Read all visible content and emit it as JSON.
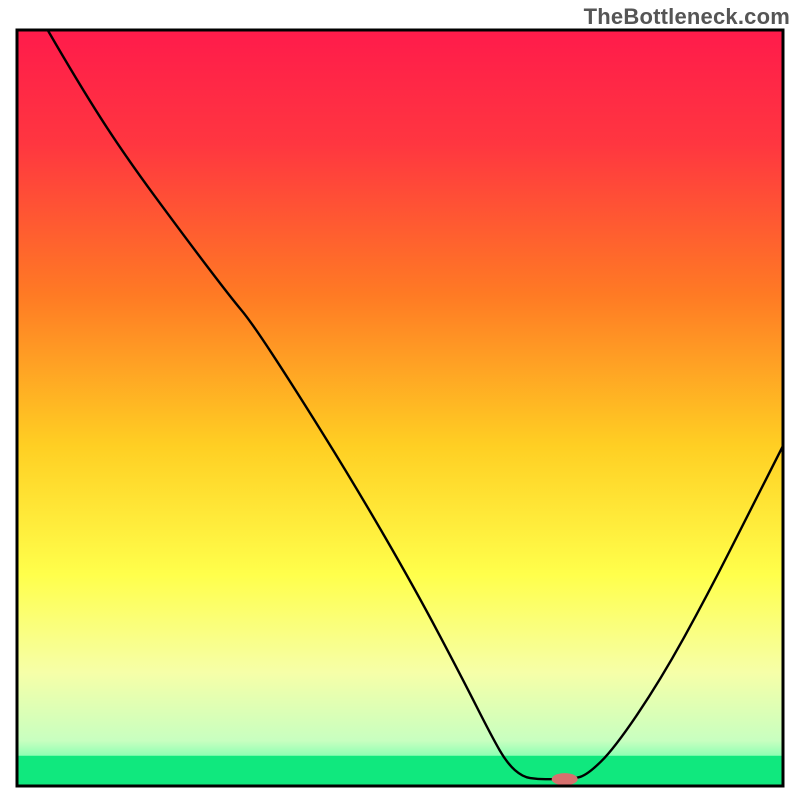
{
  "watermark": "TheBottleneck.com",
  "marker_color": "#d6706e",
  "chart_data": {
    "type": "line",
    "title": "",
    "xlabel": "",
    "ylabel": "",
    "xlim": [
      0,
      100
    ],
    "ylim": [
      0,
      100
    ],
    "gradient_stops": [
      {
        "offset": 0.0,
        "color": "#ff1b4b"
      },
      {
        "offset": 0.15,
        "color": "#ff3640"
      },
      {
        "offset": 0.35,
        "color": "#ff7a24"
      },
      {
        "offset": 0.55,
        "color": "#ffcf23"
      },
      {
        "offset": 0.72,
        "color": "#ffff4b"
      },
      {
        "offset": 0.85,
        "color": "#f6ffa8"
      },
      {
        "offset": 0.94,
        "color": "#c8ffc0"
      },
      {
        "offset": 1.0,
        "color": "#1cff9a"
      }
    ],
    "green_strip": {
      "top_pct": 96,
      "color": "#10e87e"
    },
    "series": [
      {
        "name": "curve",
        "points": [
          {
            "x": 4.0,
            "y": 100.0
          },
          {
            "x": 8.0,
            "y": 93.0
          },
          {
            "x": 14.0,
            "y": 83.5
          },
          {
            "x": 22.0,
            "y": 72.5
          },
          {
            "x": 28.0,
            "y": 64.5
          },
          {
            "x": 30.5,
            "y": 61.5
          },
          {
            "x": 36.0,
            "y": 53.0
          },
          {
            "x": 44.0,
            "y": 40.0
          },
          {
            "x": 52.0,
            "y": 26.0
          },
          {
            "x": 58.0,
            "y": 14.5
          },
          {
            "x": 62.0,
            "y": 6.5
          },
          {
            "x": 64.0,
            "y": 3.0
          },
          {
            "x": 66.0,
            "y": 1.2
          },
          {
            "x": 68.0,
            "y": 0.9
          },
          {
            "x": 70.0,
            "y": 0.9
          },
          {
            "x": 72.5,
            "y": 0.9
          },
          {
            "x": 74.5,
            "y": 1.5
          },
          {
            "x": 78.0,
            "y": 5.0
          },
          {
            "x": 84.0,
            "y": 14.0
          },
          {
            "x": 90.0,
            "y": 25.0
          },
          {
            "x": 96.0,
            "y": 37.0
          },
          {
            "x": 100.0,
            "y": 45.0
          }
        ]
      }
    ],
    "marker": {
      "x": 71.5,
      "y": 0.9,
      "rx": 1.7,
      "ry": 0.8
    }
  }
}
